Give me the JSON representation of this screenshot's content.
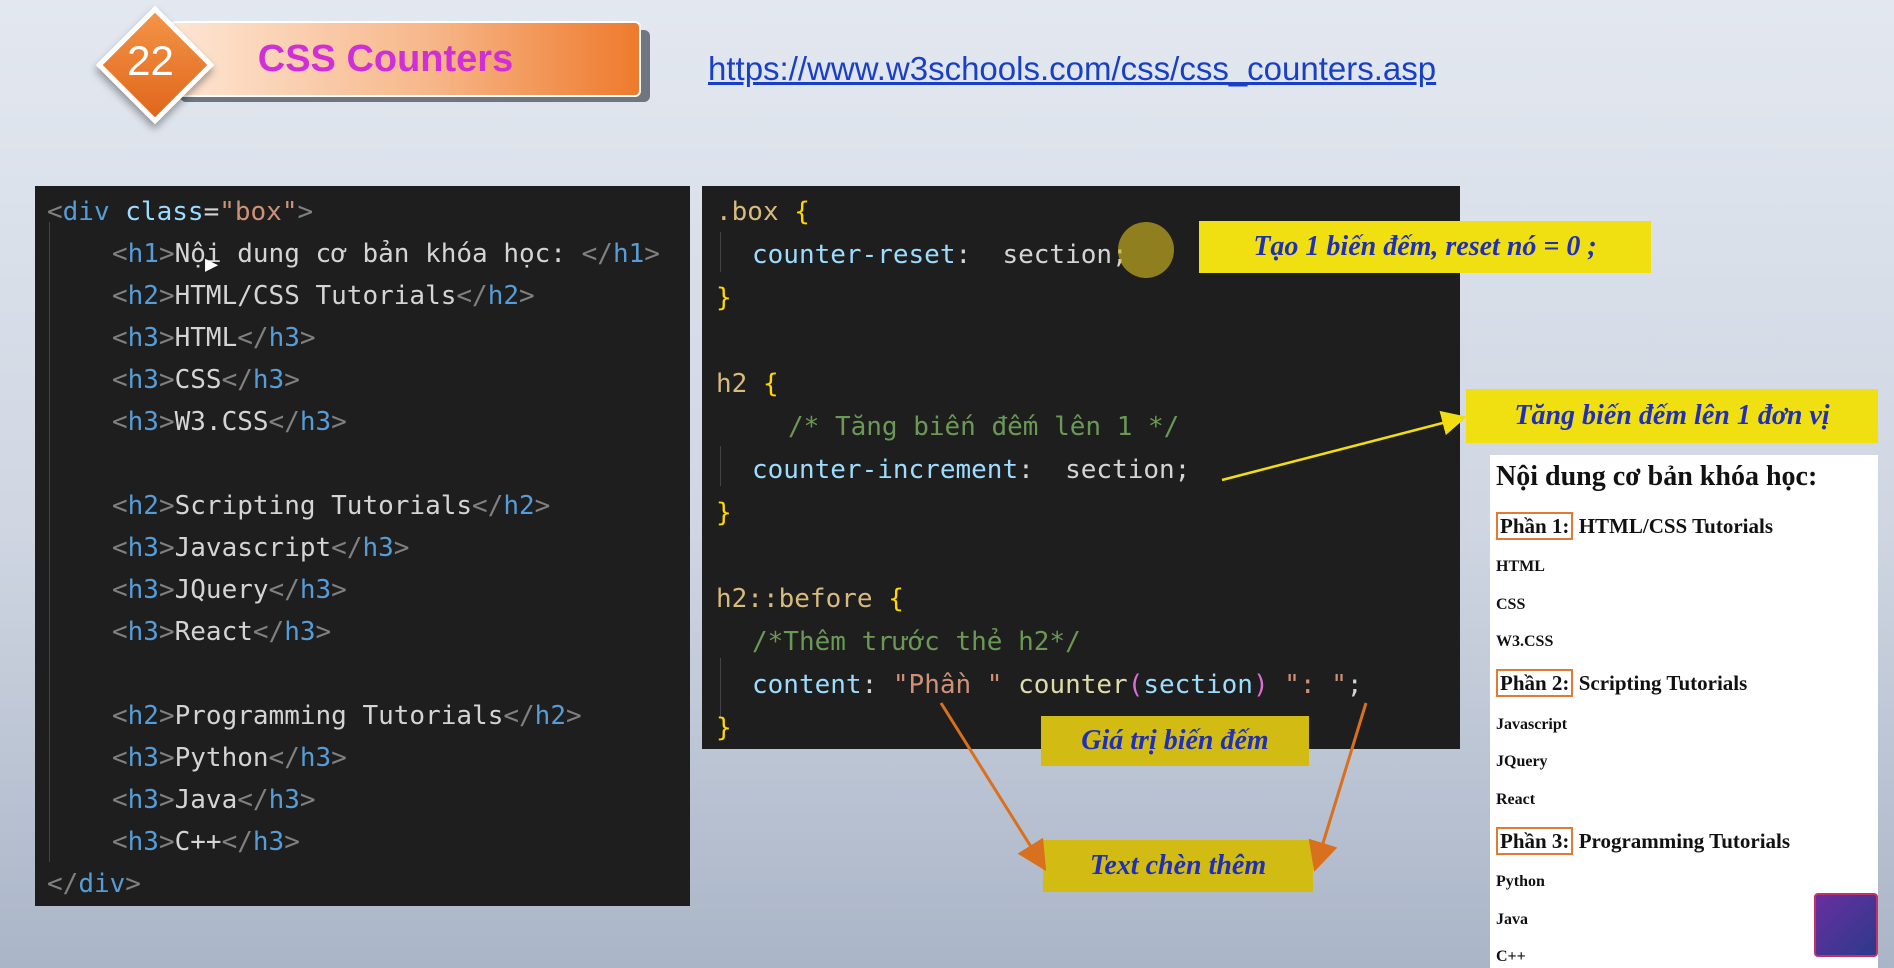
{
  "header": {
    "lesson_number": "22",
    "title": "CSS Counters",
    "url": "https://www.w3schools.com/css/css_counters.asp"
  },
  "html_code": {
    "l0_open": "<",
    "l0_tag": "div",
    "l0_attr": "class",
    "l0_eq": "=",
    "l0_val": "\"box\"",
    "l0_close": ">",
    "l1_text": "Nội dung cơ bản khóa học: ",
    "l2_text": "HTML/CSS Tutorials",
    "l3_text": "HTML",
    "l4_text": "CSS",
    "l5_text": "W3.CSS",
    "l6_text": "Scripting Tutorials",
    "l7_text": "Javascript",
    "l8_text": "JQuery",
    "l9_text": "React",
    "l10_text": "Programming Tutorials",
    "l11_text": "Python",
    "l12_text": "Java",
    "l13_text": "C++",
    "h1": "h1",
    "h2": "h2",
    "h3": "h3",
    "div": "div",
    "lt": "<",
    "gt": ">",
    "lts": "</"
  },
  "css_code": {
    "box_sel": ".box",
    "reset_prop": "counter-reset",
    "reset_val": " section;",
    "h2_sel": "h2",
    "comment1": "/* Tăng biến đếm lên 1 */",
    "inc_prop": "counter-increment",
    "inc_val": " section;",
    "before_sel": "h2::before",
    "comment2": "/*Thêm trước thẻ h2*/",
    "content_prop": "content",
    "content_str1": "\"Phần \"",
    "counter_fn": "counter",
    "counter_arg": "section",
    "content_str2": "\": \"",
    "semi": ";",
    "colon": ": ",
    "open_brace": "{",
    "close_brace": "}",
    "lparen": "(",
    "rparen": ")"
  },
  "notes": {
    "reset_note": "Tạo 1 biến đếm, reset nó = 0 ;",
    "increment_note": "Tăng biến đếm lên 1 đơn vị",
    "counter_value_note": "Giá trị biến đếm",
    "inserted_text_note": "Text chèn thêm"
  },
  "preview": {
    "h1": "Nội dung cơ bản khóa học:",
    "sections": [
      {
        "counter": "Phần 1:",
        "title": "HTML/CSS Tutorials",
        "items": [
          "HTML",
          "CSS",
          "W3.CSS"
        ]
      },
      {
        "counter": "Phần 2:",
        "title": "Scripting Tutorials",
        "items": [
          "Javascript",
          "JQuery",
          "React"
        ]
      },
      {
        "counter": "Phần 3:",
        "title": "Programming Tutorials",
        "items": [
          "Python",
          "Java",
          "C++"
        ]
      }
    ]
  },
  "colors": {
    "note_yellow": "#f0e011",
    "note_text": "#1f2fb8",
    "title_text": "#d12fd6",
    "url": "#1a3fc7",
    "code_bg": "#1e1e1e"
  }
}
